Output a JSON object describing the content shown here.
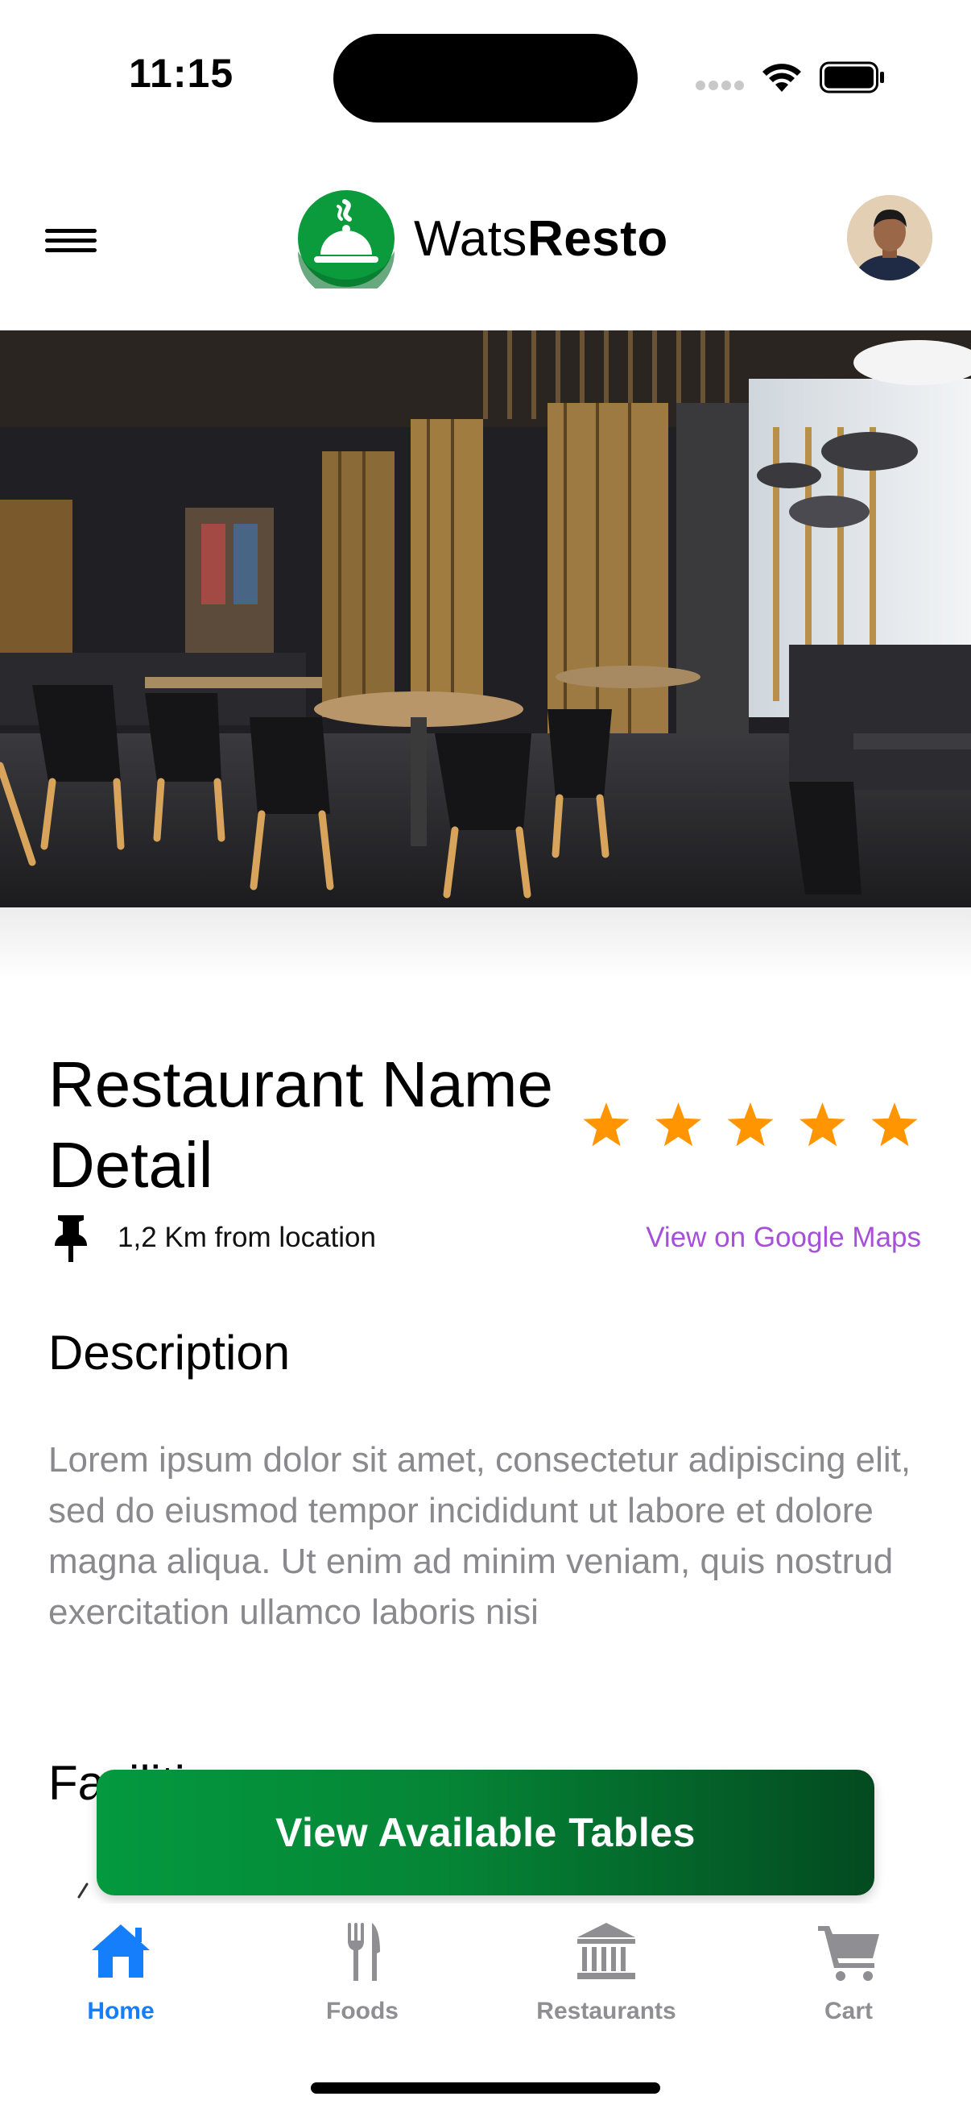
{
  "status_bar": {
    "time": "11:15"
  },
  "header": {
    "brand_regular": "Wats",
    "brand_bold": "Resto",
    "menu_icon": "hamburger-menu-icon",
    "logo_icon": "cloche-logo-icon",
    "brand_color": "#0b9a3c"
  },
  "restaurant": {
    "name": "Restaurant Name Detail",
    "rating": 5,
    "rating_max": 5,
    "star_color": "#ff9500",
    "distance": "1,2 Km from location",
    "maps_link": "View on Google Maps",
    "maps_link_color": "#a64fd8"
  },
  "description": {
    "heading": "Description",
    "text": "Lorem ipsum dolor sit amet, consectetur adipiscing elit, sed do eiusmod tempor incididunt ut labore et dolore magna aliqua. Ut enim ad minim veniam, quis nostrud exercitation ullamco laboris nisi"
  },
  "facilities": {
    "heading": "Facilities"
  },
  "cta": {
    "label": "View Available Tables",
    "gradient_start": "#04993f",
    "gradient_end": "#034a20"
  },
  "tabbar": {
    "active_color": "#147efb",
    "inactive_color": "#8e8e93",
    "tabs": [
      {
        "label": "Home",
        "icon": "house-icon",
        "active": true
      },
      {
        "label": "Foods",
        "icon": "fork-knife-icon",
        "active": false
      },
      {
        "label": "Restaurants",
        "icon": "building-columns-icon",
        "active": false
      },
      {
        "label": "Cart",
        "icon": "cart-icon",
        "active": false
      }
    ]
  }
}
